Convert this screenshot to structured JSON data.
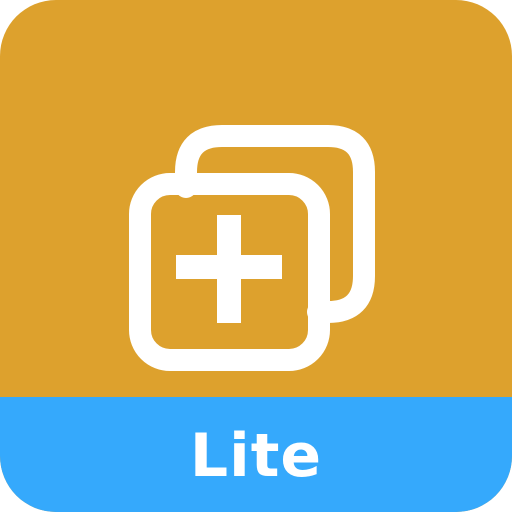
{
  "icon": {
    "glyph": "add-copy-icon",
    "colors": {
      "background": "#DDA12D",
      "banner": "#35A9FC",
      "foreground": "#FFFFFF"
    }
  },
  "banner": {
    "label": "Lite"
  }
}
